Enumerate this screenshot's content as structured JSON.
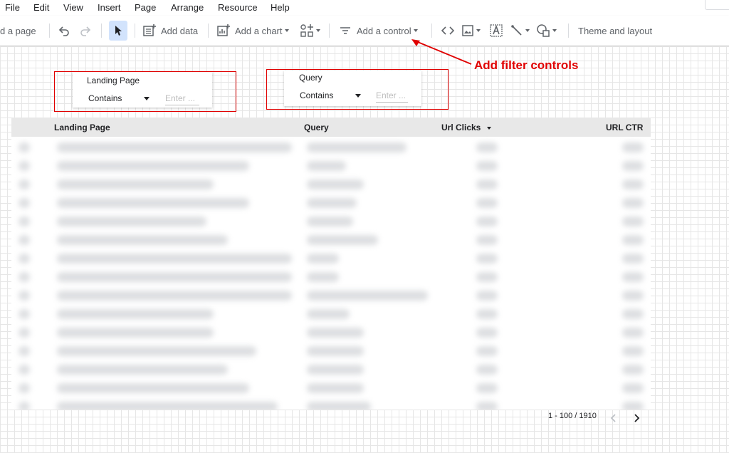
{
  "menu": [
    "File",
    "Edit",
    "View",
    "Insert",
    "Page",
    "Arrange",
    "Resource",
    "Help"
  ],
  "toolbar": {
    "add_page_label": "d a page",
    "add_data_label": "Add data",
    "add_chart_label": "Add a chart",
    "add_control_label": "Add a control",
    "theme_label": "Theme and layout"
  },
  "filters": [
    {
      "title": "Landing Page",
      "operator": "Contains",
      "placeholder": "Enter ..."
    },
    {
      "title": "Query",
      "operator": "Contains",
      "placeholder": "Enter ..."
    }
  ],
  "annotation": {
    "text": "Add filter controls",
    "color": "#e00000"
  },
  "table": {
    "columns": [
      "Landing Page",
      "Query",
      "Url Clicks",
      "URL CTR"
    ],
    "sorted_column": "Url Clicks",
    "sort_direction": "descending",
    "row_count_visible": 15,
    "pagination": "1 - 100 / 1910"
  },
  "colors": {
    "accent": "#1a73e8",
    "select_highlight": "#d2e3fc",
    "annotation": "#e00000"
  }
}
